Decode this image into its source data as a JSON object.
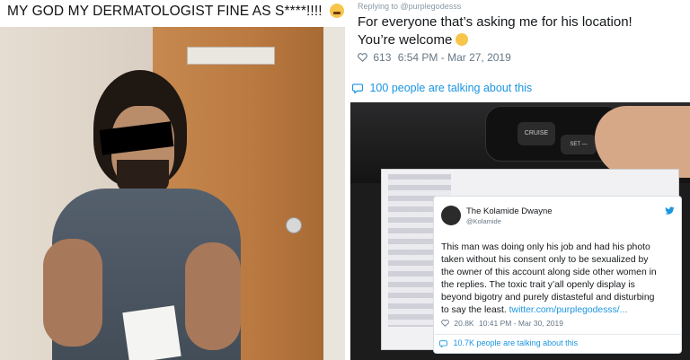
{
  "left": {
    "title": "MY GOD MY DERMATOLOGIST FINE AS S****!!!!",
    "emoji": "grimace-emoji"
  },
  "tweet": {
    "reply_to": "Replying to @purplegodesss",
    "text_line1": "For everyone that’s asking me for his location!",
    "text_line2": "You’re welcome",
    "likes": "613",
    "timestamp": "6:54 PM - Mar 27, 2019",
    "talking": "100 people are talking about this"
  },
  "photo_right": {
    "btn_cruise": "CRUISE",
    "btn_set": "SET —"
  },
  "embed": {
    "name": "The Kolamide Dwayne",
    "handle": "@Kolamide",
    "lines": [
      "This man was doing only his job and had his photo",
      "taken without his consent only to be sexualized by",
      "the owner of this account along side other women in",
      "the replies. The toxic trait y’all openly display is",
      "beyond bigotry and purely distasteful and disturbing"
    ],
    "last_text": "to say the least.",
    "link": "twitter.com/purplegodesss/...",
    "likes": "20.8K",
    "timestamp": "10:41 PM - Mar 30, 2019",
    "talking": "10.7K people are talking about this"
  },
  "colors": {
    "link": "#1b95e0",
    "meta": "#657786",
    "text": "#14171a"
  }
}
